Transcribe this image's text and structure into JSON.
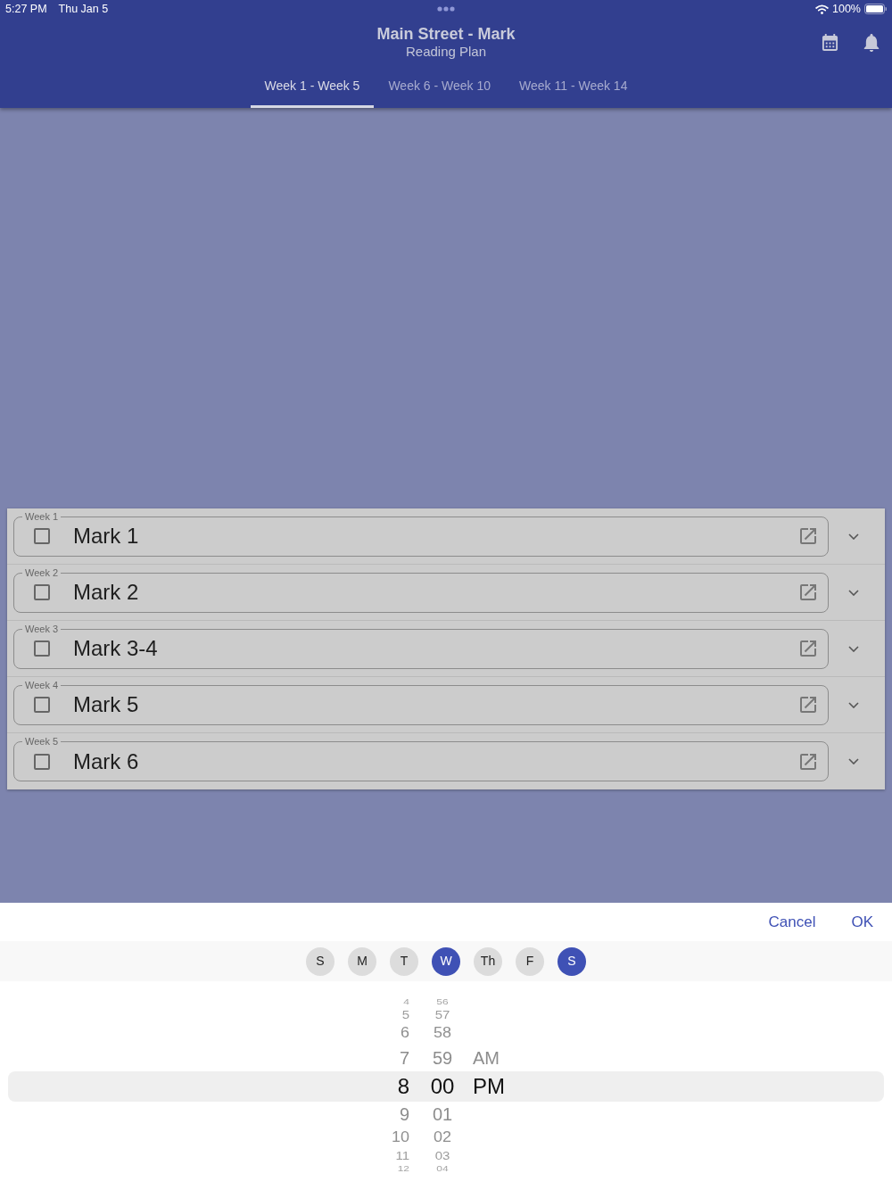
{
  "status_bar": {
    "time": "5:27 PM",
    "date": "Thu Jan 5",
    "battery": "100%"
  },
  "header": {
    "title": "Main Street - Mark",
    "subtitle": "Reading Plan"
  },
  "tabs": [
    {
      "label": "Week 1 - Week 5",
      "selected": true
    },
    {
      "label": "Week 6 - Week 10",
      "selected": false
    },
    {
      "label": "Week 11 - Week 14",
      "selected": false
    }
  ],
  "readings": [
    {
      "week": "Week 1",
      "title": "Mark 1",
      "checked": false
    },
    {
      "week": "Week 2",
      "title": "Mark 2",
      "checked": false
    },
    {
      "week": "Week 3",
      "title": "Mark 3-4",
      "checked": false
    },
    {
      "week": "Week 4",
      "title": "Mark 5",
      "checked": false
    },
    {
      "week": "Week 5",
      "title": "Mark 6",
      "checked": false
    }
  ],
  "time_picker": {
    "cancel": "Cancel",
    "ok": "OK",
    "days": [
      {
        "label": "S",
        "selected": false
      },
      {
        "label": "M",
        "selected": false
      },
      {
        "label": "T",
        "selected": false
      },
      {
        "label": "W",
        "selected": true
      },
      {
        "label": "Th",
        "selected": false
      },
      {
        "label": "F",
        "selected": false
      },
      {
        "label": "S",
        "selected": true
      }
    ],
    "hours": [
      {
        "label": "4",
        "selected": false
      },
      {
        "label": "5",
        "selected": false
      },
      {
        "label": "6",
        "selected": false
      },
      {
        "label": "7",
        "selected": false
      },
      {
        "label": "8",
        "selected": true
      },
      {
        "label": "9",
        "selected": false
      },
      {
        "label": "10",
        "selected": false
      },
      {
        "label": "11",
        "selected": false
      },
      {
        "label": "12",
        "selected": false
      }
    ],
    "minutes": [
      {
        "label": "56",
        "selected": false
      },
      {
        "label": "57",
        "selected": false
      },
      {
        "label": "58",
        "selected": false
      },
      {
        "label": "59",
        "selected": false
      },
      {
        "label": "00",
        "selected": true
      },
      {
        "label": "01",
        "selected": false
      },
      {
        "label": "02",
        "selected": false
      },
      {
        "label": "03",
        "selected": false
      },
      {
        "label": "04",
        "selected": false
      }
    ],
    "periods": [
      {
        "label": "AM",
        "selected": false
      },
      {
        "label": "PM",
        "selected": true
      }
    ]
  }
}
